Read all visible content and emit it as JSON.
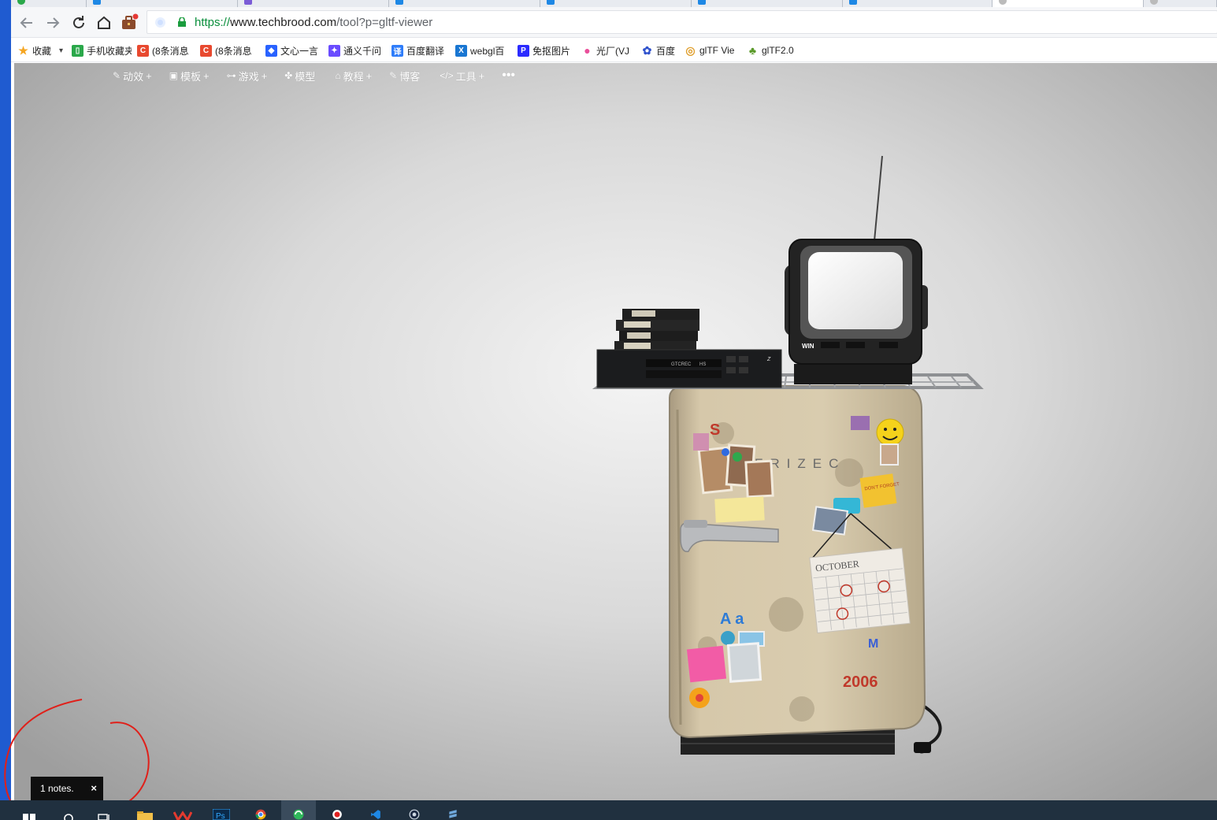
{
  "browser": {
    "url_protocol": "https://",
    "url_host": "www.techbrood.com",
    "url_path": "/tool?p=gltf-viewer"
  },
  "bookmarks": [
    {
      "label": "收藏",
      "icon": "star-icon",
      "color": "#f5a623"
    },
    {
      "label": "手机收藏夹",
      "icon": "phone-icon",
      "color": "#2aa84a"
    },
    {
      "label": "(8条消息",
      "icon": "csdn-icon",
      "color": "#e8492f"
    },
    {
      "label": "(8条消息",
      "icon": "csdn-icon",
      "color": "#e8492f"
    },
    {
      "label": "文心一言",
      "icon": "wenxin-icon",
      "color": "#2962ff"
    },
    {
      "label": "通义千问",
      "icon": "tongyi-icon",
      "color": "#6a4cff"
    },
    {
      "label": "百度翻译",
      "icon": "translate-icon",
      "color": "#2f7dfa"
    },
    {
      "label": "webgl百",
      "icon": "x-icon",
      "color": "#1976d2"
    },
    {
      "label": "免抠图片",
      "icon": "p-icon",
      "color": "#2b2bff"
    },
    {
      "label": "光厂(VJ",
      "icon": "guangchang-icon",
      "color": "#e94e9a"
    },
    {
      "label": "百度",
      "icon": "baidu-paw-icon",
      "color": "#2f52cc"
    },
    {
      "label": "glTF Vie",
      "icon": "gltf-icon",
      "color": "#e0a030"
    },
    {
      "label": "glTF2.0",
      "icon": "tree-icon",
      "color": "#5a9a2a"
    }
  ],
  "site_nav": [
    {
      "label": "动效",
      "glyph": "✎",
      "plus": "+"
    },
    {
      "label": "模板",
      "glyph": "▣",
      "plus": "+"
    },
    {
      "label": "游戏",
      "glyph": "⊶",
      "plus": "+"
    },
    {
      "label": "模型",
      "glyph": "✤",
      "plus": ""
    },
    {
      "label": "教程",
      "glyph": "⌂",
      "plus": "+"
    },
    {
      "label": "博客",
      "glyph": "✎",
      "plus": ""
    },
    {
      "label": "工具",
      "glyph": "</>",
      "plus": "+"
    }
  ],
  "site_more": "•••",
  "scene": {
    "fridge_brand": "FRIZEC",
    "fridge_letter_s": "S",
    "magnet_letters": "A a",
    "fridge_year": "2006",
    "calendar_month": "OCTOBER",
    "calendar_year": "2006",
    "sticky_note": "DON'T FORGET TO RECORD AGAIN",
    "vcr_brand": "GTCREC",
    "vcr_model": "HS",
    "tv_brand": "WIN"
  },
  "notes": {
    "text": "1 notes.",
    "close": "×"
  },
  "colors": {
    "annotation": "#e0201a",
    "taskbar": "#20303f",
    "windows_accent": "#1f5bd0"
  }
}
